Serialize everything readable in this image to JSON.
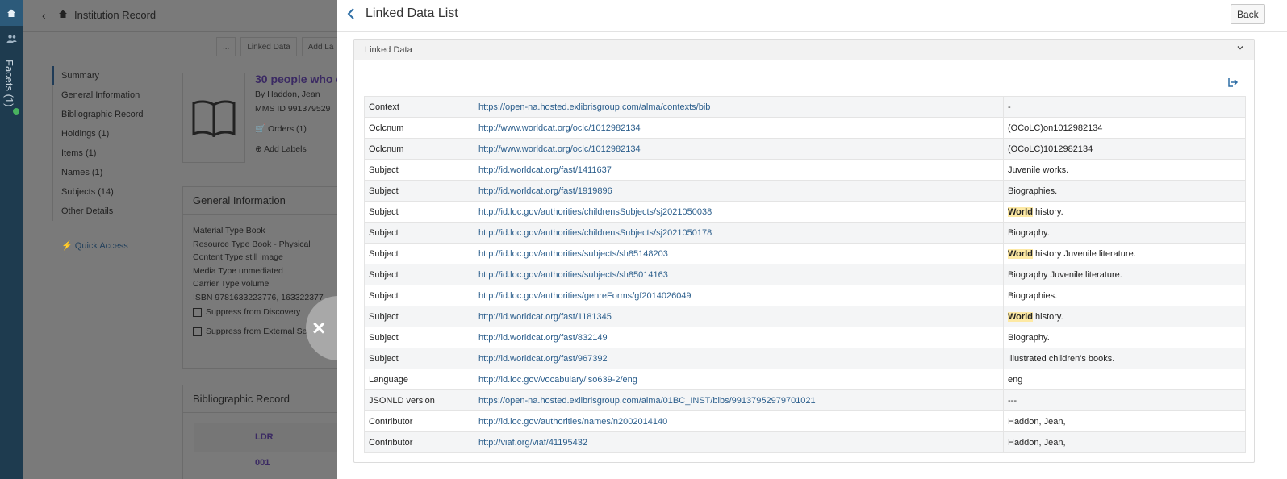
{
  "background_page": {
    "title": "Institution Record",
    "toolbar": [
      "...",
      "Linked Data",
      "Add La"
    ],
    "nav": [
      "Summary",
      "General Information",
      "Bibliographic Record",
      "Holdings (1)",
      "Items (1)",
      "Names (1)",
      "Subjects (14)",
      "Other Details"
    ],
    "quick_access": "Quick Access",
    "book_title": "30 people who c",
    "by_line": "By  Haddon, Jean",
    "mms_id": "MMS ID 991379529",
    "orders": "Orders (1)",
    "add_labels": "Add Labels",
    "general_info_heading": "General Information",
    "general_info": [
      "Material Type Book",
      "Resource Type Book - Physical",
      "Content Type still image",
      "Media Type unmediated",
      "Carrier Type volume",
      "ISBN 9781633223776, 163322377"
    ],
    "suppress_discovery": "Suppress from Discovery",
    "suppress_external": "Suppress from External Sea",
    "bib_record_heading": "Bibliographic Record",
    "ldr": "LDR",
    "field_001": "001",
    "facets": "Facets (1)"
  },
  "drawer": {
    "title": "Linked Data List",
    "back_button": "Back",
    "section_title": "Linked Data",
    "rows": [
      {
        "label": "Context",
        "uri": "https://open-na.hosted.exlibrisgroup.com/alma/contexts/bib",
        "value": "-"
      },
      {
        "label": "Oclcnum",
        "uri": "http://www.worldcat.org/oclc/1012982134",
        "value": "(OCoLC)on1012982134"
      },
      {
        "label": "Oclcnum",
        "uri": "http://www.worldcat.org/oclc/1012982134",
        "value": "(OCoLC)1012982134"
      },
      {
        "label": "Subject",
        "uri": "http://id.worldcat.org/fast/1411637",
        "value": "Juvenile works."
      },
      {
        "label": "Subject",
        "uri": "http://id.worldcat.org/fast/1919896",
        "value": "Biographies."
      },
      {
        "label": "Subject",
        "uri": "http://id.loc.gov/authorities/childrensSubjects/sj2021050038",
        "value_hl": "World",
        "value": " history."
      },
      {
        "label": "Subject",
        "uri": "http://id.loc.gov/authorities/childrensSubjects/sj2021050178",
        "value": "Biography."
      },
      {
        "label": "Subject",
        "uri": "http://id.loc.gov/authorities/subjects/sh85148203",
        "value_hl": "World",
        "value": " history Juvenile literature."
      },
      {
        "label": "Subject",
        "uri": "http://id.loc.gov/authorities/subjects/sh85014163",
        "value": "Biography Juvenile literature."
      },
      {
        "label": "Subject",
        "uri": "http://id.loc.gov/authorities/genreForms/gf2014026049",
        "value": "Biographies."
      },
      {
        "label": "Subject",
        "uri": "http://id.worldcat.org/fast/1181345",
        "value_hl": "World",
        "value": " history."
      },
      {
        "label": "Subject",
        "uri": "http://id.worldcat.org/fast/832149",
        "value": "Biography."
      },
      {
        "label": "Subject",
        "uri": "http://id.worldcat.org/fast/967392",
        "value": "Illustrated children's books."
      },
      {
        "label": "Language",
        "uri": "http://id.loc.gov/vocabulary/iso639-2/eng",
        "value": "eng"
      },
      {
        "label": "JSONLD version",
        "uri": "https://open-na.hosted.exlibrisgroup.com/alma/01BC_INST/bibs/99137952979701021",
        "value": "---"
      },
      {
        "label": "Contributor",
        "uri": "http://id.loc.gov/authorities/names/n2002014140",
        "value": "Haddon, Jean,"
      },
      {
        "label": "Contributor",
        "uri": "http://viaf.org/viaf/41195432",
        "value": "Haddon, Jean,"
      }
    ]
  },
  "icons": {
    "close": "×",
    "back_chevron": "‹",
    "chevron_down": "⌄",
    "export": "⇥",
    "home": "⌂"
  },
  "colors": {
    "link": "#2b5e8c",
    "highlight": "#fde9a4",
    "rail": "#1e3b4f"
  }
}
